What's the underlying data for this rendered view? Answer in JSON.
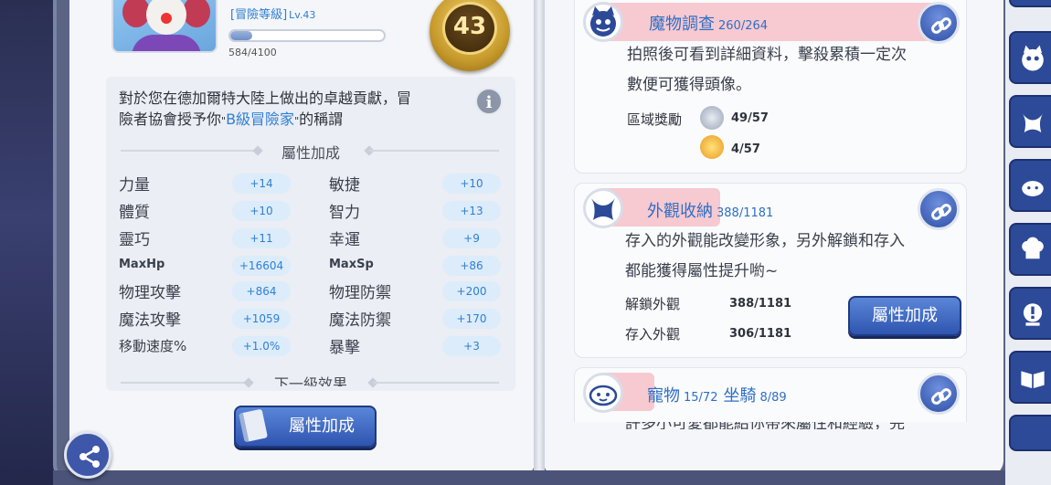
{
  "character": {
    "rank_label": "[冒險等級]",
    "level_label": "Lv.43",
    "xp_text": "584/4100",
    "xp_fraction": 0.142,
    "badge_number": "43"
  },
  "description": {
    "line1": "對於您在德加爾特大陸上做出的卓越貢獻，冒",
    "line2_pre": "險者協會授予你",
    "line2_q_open": "\"",
    "line2_rank": "B級冒險家",
    "line2_q_close": "\"",
    "line2_post": "的稱謂"
  },
  "attr_section_title": "屬性加成",
  "stats": [
    {
      "name": "力量",
      "value": "+14",
      "name2": "敏捷",
      "value2": "+10"
    },
    {
      "name": "體質",
      "value": "+10",
      "name2": "智力",
      "value2": "+13"
    },
    {
      "name": "靈巧",
      "value": "+11",
      "name2": "幸運",
      "value2": "+9"
    },
    {
      "name": "MaxHp",
      "value": "+16604",
      "name2": "MaxSp",
      "value2": "+86"
    },
    {
      "name": "物理攻擊",
      "value": "+864",
      "name2": "物理防禦",
      "value2": "+200"
    },
    {
      "name": "魔法攻擊",
      "value": "+1059",
      "name2": "魔法防禦",
      "value2": "+170"
    },
    {
      "name": "移動速度%",
      "value": "+1.0%",
      "name2": "暴擊",
      "value2": "+3"
    }
  ],
  "next_level_title": "下一級效果",
  "left_button_label": "屬性加成",
  "monster_card": {
    "title": "魔物調查",
    "count": "260/264",
    "text1": "拍照後可看到詳細資料，擊殺累積一定次",
    "text2": "數便可獲得頭像。",
    "reward_label": "區域獎勵",
    "reward1_value": "49/57",
    "reward2_value": "4/57",
    "reward1_tag": "Color",
    "reward2_tag": "Perfect"
  },
  "appearance_card": {
    "title": "外觀收納",
    "count": "388/1181",
    "text1": "存入的外觀能改變形象，另外解鎖和存入",
    "text2": "都能獲得屬性提升喲~",
    "unlock_label": "解鎖外觀",
    "unlock_value": "388/1181",
    "store_label": "存入外觀",
    "store_value": "306/1181",
    "button_label": "屬性加成"
  },
  "pet_card": {
    "title1": "寵物",
    "count1": "15/72",
    "title2": "坐騎",
    "count2": "8/89",
    "text1": "許多小可愛都能給你帶來屬性和經驗，完"
  },
  "colors": {
    "accent_blue": "#2f7fd4",
    "button_blue": "#3a62c0",
    "tab_pink": "#f7c9d1",
    "page_bg": "#f4f6f9"
  },
  "icons": [
    "share-icon",
    "link-icon",
    "info-icon",
    "cat-icon",
    "bat-icon",
    "poring-icon",
    "chef-icon",
    "alert-icon",
    "book-icon"
  ]
}
